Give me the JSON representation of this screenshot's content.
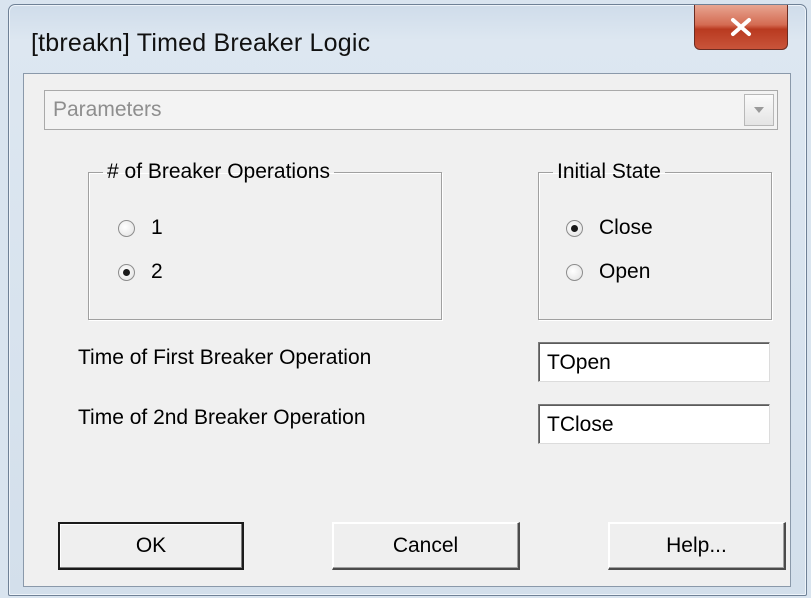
{
  "window": {
    "title": "[tbreakn] Timed Breaker Logic"
  },
  "close_button": {
    "icon": "close-icon",
    "color": "#c9543a"
  },
  "section_select": {
    "value": "Parameters"
  },
  "breaker_ops_group": {
    "legend": "# of Breaker Operations",
    "options": [
      {
        "label": "1",
        "checked": false
      },
      {
        "label": "2",
        "checked": true
      }
    ]
  },
  "initial_state_group": {
    "legend": "Initial State",
    "options": [
      {
        "label": "Close",
        "checked": true
      },
      {
        "label": "Open",
        "checked": false
      }
    ]
  },
  "fields": {
    "first_op": {
      "label": "Time of First Breaker Operation",
      "value": "TOpen"
    },
    "second_op": {
      "label": "Time of 2nd Breaker Operation",
      "value": "TClose"
    }
  },
  "buttons": {
    "ok": "OK",
    "cancel": "Cancel",
    "help": "Help..."
  }
}
